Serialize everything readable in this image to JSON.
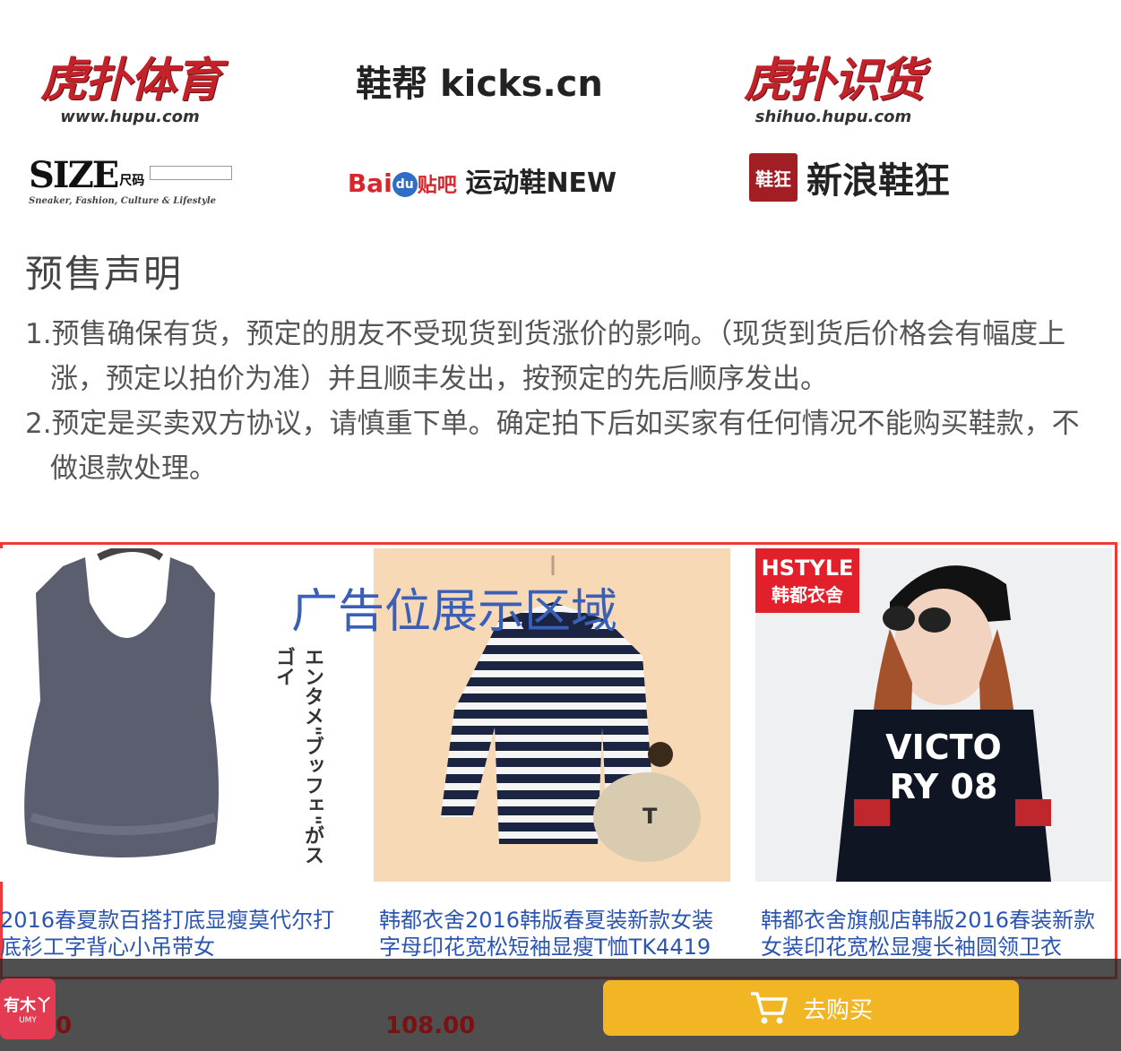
{
  "logos": {
    "hupu": {
      "name": "虎扑体育",
      "url": "www.hupu.com"
    },
    "kicks": {
      "name": "鞋帮 kicks.cn"
    },
    "shihuo": {
      "name": "虎扑识货",
      "url": "shihuo.hupu.com"
    },
    "size": {
      "name": "SIZE",
      "tag": "尺码",
      "subtitle": "Sneaker, Fashion, Culture & Lifestyle"
    },
    "baidu": {
      "bai": "Bai",
      "du": "du",
      "tieba": "贴吧",
      "name": "运动鞋NEW"
    },
    "sina": {
      "badge": "鞋狂",
      "name": "新浪鞋狂"
    }
  },
  "presale": {
    "title": "预售声明",
    "items": [
      "1.预售确保有货，预定的朋友不受现货到货涨价的影响。（现货到货后价格会有幅度上涨，预定以拍价为准）并且顺丰发出，按预定的先后顺序发出。",
      "2.预定是买卖双方协议，请慎重下单。确定拍下后如买家有任何情况不能购买鞋款，不做退款处理。"
    ]
  },
  "ad": {
    "label": "广告位展示区域",
    "products": [
      {
        "title_line1": "2016春夏款百搭打底显瘦莫代尔打",
        "title_line2": "底衫工字背心小吊带女",
        "image_text": "エンタメ\"ブッフェ\"がスゴイ"
      },
      {
        "title_line1": "韩都衣舍2016韩版春夏装新款女装",
        "title_line2": "字母印花宽松短袖显瘦T恤TK4419",
        "image_text": "T"
      },
      {
        "title_line1": "韩都衣舍旗舰店韩版2016春装新款",
        "title_line2": "女装印花宽松显瘦长袖圆领卫衣",
        "brand_top": "HSTYLE",
        "brand_bottom": "韩都衣舍",
        "image_text": "VICTORY 08"
      }
    ]
  },
  "bottom": {
    "shop_logo": "有木丫",
    "price_left": "0",
    "price": "108.00",
    "buy_label": "去购买"
  },
  "colors": {
    "ad_border": "#ee3a3a",
    "ad_label": "#3a5fb8",
    "buy_button": "#f2b624",
    "price": "#7a1212"
  }
}
